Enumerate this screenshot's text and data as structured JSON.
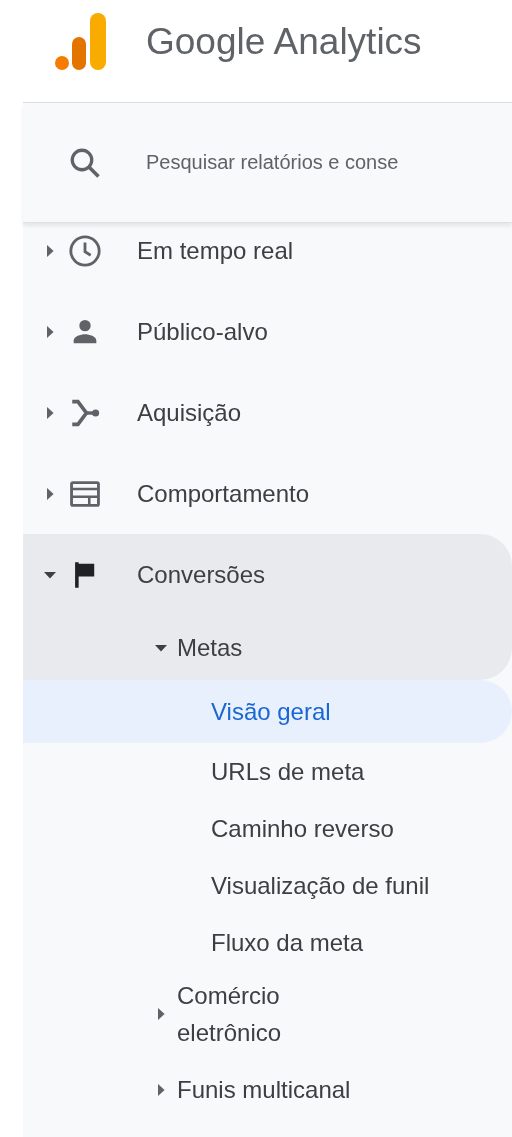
{
  "header": {
    "title": "Google Analytics"
  },
  "search": {
    "placeholder": "Pesquisar relatórios e conse"
  },
  "nav": [
    {
      "label": "Em tempo real",
      "expanded": false
    },
    {
      "label": "Público-alvo",
      "expanded": false
    },
    {
      "label": "Aquisição",
      "expanded": false
    },
    {
      "label": "Comportamento",
      "expanded": false
    },
    {
      "label": "Conversões",
      "expanded": true,
      "children": [
        {
          "label": "Metas",
          "expanded": true,
          "children": [
            {
              "label": "Visão geral",
              "selected": true
            },
            {
              "label": "URLs de meta",
              "selected": false
            },
            {
              "label": "Caminho reverso",
              "selected": false
            },
            {
              "label": "Visualização de funil",
              "selected": false
            },
            {
              "label": "Fluxo da meta",
              "selected": false
            }
          ]
        },
        {
          "label": "Comércio eletrônico",
          "expanded": false
        },
        {
          "label": "Funis multicanal",
          "expanded": false
        }
      ]
    }
  ]
}
